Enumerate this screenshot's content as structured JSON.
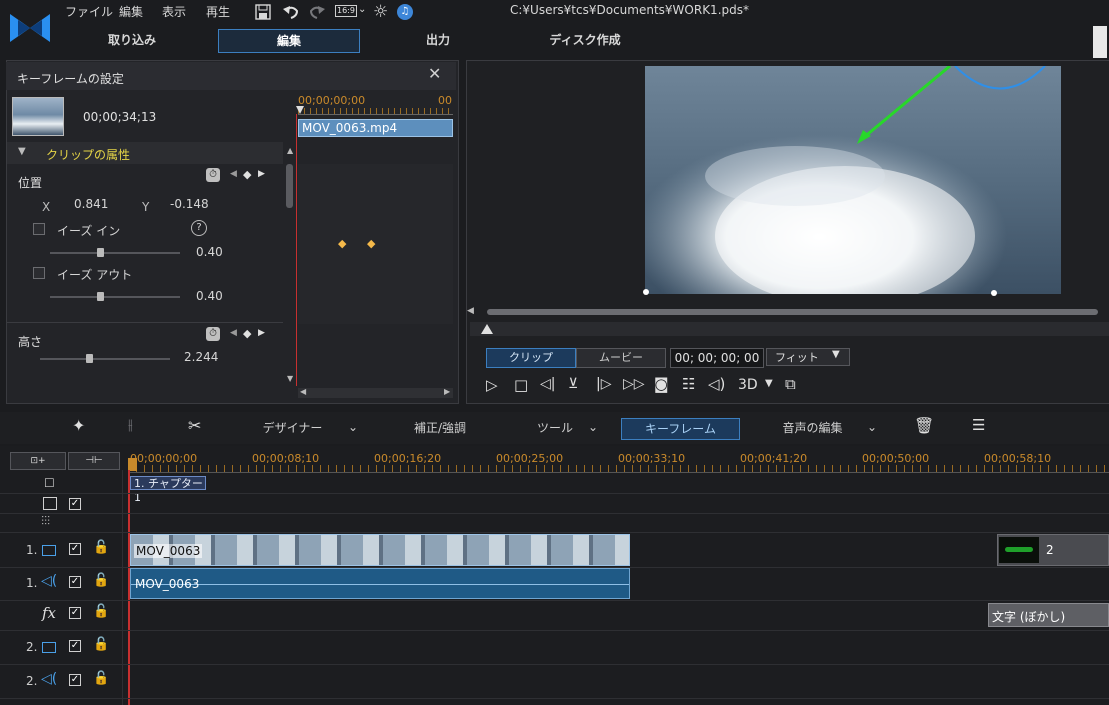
{
  "menubar": {
    "menus": [
      "ファイル",
      "編集",
      "表示",
      "再生"
    ],
    "aspect": "16:9",
    "title": "C:¥Users¥tcs¥Documents¥WORK1.pds*"
  },
  "tabs": [
    {
      "label": "取り込み"
    },
    {
      "label": "編集",
      "active": true
    },
    {
      "label": "出力"
    },
    {
      "label": "ディスク作成"
    }
  ],
  "keyframe_panel": {
    "title": "キーフレームの設定",
    "timecode": "00;00;34;13",
    "ruler_start": "00;00;00;00",
    "ruler_cut": "00",
    "clip_name": "MOV_0063.mp4",
    "section": "クリップの属性",
    "position": {
      "label": "位置",
      "x_label": "X",
      "x_value": "0.841",
      "y_label": "Y",
      "y_value": "-0.148"
    },
    "ease_in": {
      "label": "イーズ イン",
      "value": "0.40",
      "help": "?"
    },
    "ease_out": {
      "label": "イーズ アウト",
      "value": "0.40"
    },
    "height": {
      "label": "高さ",
      "value": "2.244"
    }
  },
  "preview": {
    "mode_clip": "クリップ",
    "mode_movie": "ムービー",
    "timecode": "00; 00; 00; 00",
    "fit": "フィット",
    "three_d": "3D"
  },
  "toolbar": {
    "designer": "デザイナー",
    "correct": "補正/強調",
    "tools": "ツール",
    "keyframe": "キーフレーム",
    "audio_edit": "音声の編集"
  },
  "timeline": {
    "ruler": [
      "00;00;00;00",
      "00;00;08;10",
      "00;00;16;20",
      "00;00;25;00",
      "00;00;33;10",
      "00;00;41;20",
      "00;00;50;00",
      "00;00;58;10"
    ],
    "chapter": "1. チャプター 1",
    "tracks": [
      {
        "num": "1.",
        "kind": "video"
      },
      {
        "num": "1.",
        "kind": "audio"
      },
      {
        "num": "fx",
        "kind": "fx"
      },
      {
        "num": "2.",
        "kind": "video"
      },
      {
        "num": "2.",
        "kind": "audio"
      }
    ],
    "video_clip": "MOV_0063",
    "audio_clip": "MOV_0063",
    "thumb_clip_label": "2",
    "text_clip": "文字 (ぼかし)"
  }
}
